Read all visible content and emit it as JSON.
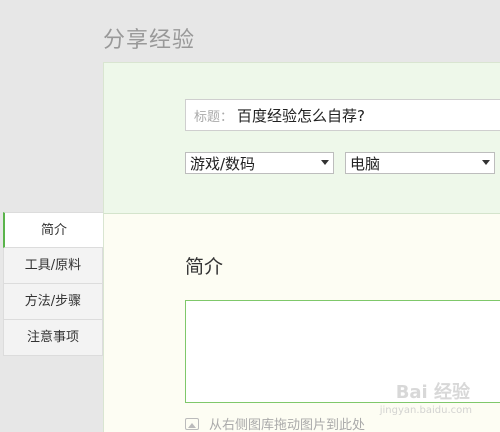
{
  "page": {
    "title": "分享经验"
  },
  "form": {
    "title_label": "标题：",
    "title_value": "百度经验怎么自荐?",
    "category_primary": "游戏/数码",
    "category_secondary": "电脑"
  },
  "tabs": [
    {
      "label": "简介"
    },
    {
      "label": "工具/原料"
    },
    {
      "label": "方法/步骤"
    },
    {
      "label": "注意事项"
    }
  ],
  "section": {
    "heading": "简介",
    "textarea_value": "",
    "image_hint": "从右侧图库拖动图片到此处"
  },
  "watermark": {
    "text": "Bai 经验",
    "sub": "jingyan.baidu.com"
  }
}
